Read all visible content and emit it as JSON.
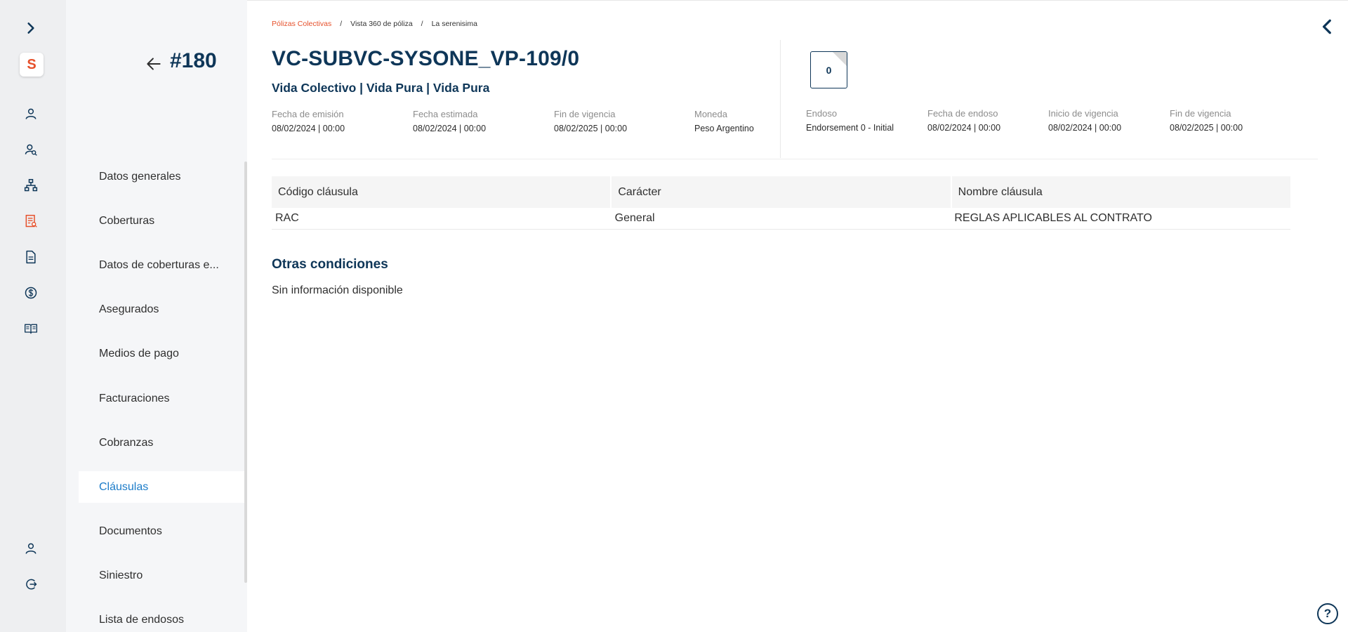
{
  "colors": {
    "accent_blue": "#1c7cc9",
    "navy": "#0e3658",
    "brand_orange": "#e6502b",
    "rail_bg": "#eeeff1"
  },
  "logo": {
    "letter": "S"
  },
  "rail": {
    "icons": [
      "chevron-right-icon",
      "user-icon",
      "users-search-icon",
      "hierarchy-icon",
      "policy-list-icon",
      "document-icon",
      "dollar-icon",
      "book-icon",
      "user-profile-icon",
      "logout-icon"
    ]
  },
  "policy": {
    "id": "#180"
  },
  "menu": {
    "items": [
      {
        "label": "Datos generales"
      },
      {
        "label": "Coberturas"
      },
      {
        "label": "Datos de coberturas e..."
      },
      {
        "label": "Asegurados"
      },
      {
        "label": "Medios de pago"
      },
      {
        "label": "Facturaciones"
      },
      {
        "label": "Cobranzas"
      },
      {
        "label": "Cláusulas"
      },
      {
        "label": "Documentos"
      },
      {
        "label": "Siniestro"
      },
      {
        "label": "Lista de endosos"
      }
    ],
    "active": "Cláusulas"
  },
  "breadcrumb": {
    "b0": "Pólizas Colectivas",
    "b1": "Vista 360 de póliza",
    "b2": "La serenisima"
  },
  "header": {
    "title": "VC-SUBVC-SYSONE_VP-109/0",
    "subtitle": "Vida Colectivo | Vida Pura | Vida Pura",
    "fields": {
      "emision": {
        "label": "Fecha de emisión",
        "value": "08/02/2024 | 00:00"
      },
      "estimada": {
        "label": "Fecha estimada",
        "value": "08/02/2024 | 00:00"
      },
      "fin": {
        "label": "Fin de vigencia",
        "value": "08/02/2025 | 00:00"
      },
      "moneda": {
        "label": "Moneda",
        "value": "Peso Argentino"
      }
    }
  },
  "endorsement": {
    "number": "0",
    "fields": {
      "endoso": {
        "label": "Endoso",
        "value": "Endorsement 0 - Initial"
      },
      "fecha": {
        "label": "Fecha de endoso",
        "value": "08/02/2024 | 00:00"
      },
      "inicio": {
        "label": "Inicio de vigencia",
        "value": "08/02/2024 | 00:00"
      },
      "fin": {
        "label": "Fin de vigencia",
        "value": "08/02/2025 | 00:00"
      }
    }
  },
  "clauses_table": {
    "headers": {
      "h0": "Código cláusula",
      "h1": "Carácter",
      "h2": "Nombre cláusula"
    },
    "rows": [
      {
        "codigo": "RAC",
        "caracter": "General",
        "nombre": "REGLAS APLICABLES AL CONTRATO"
      }
    ]
  },
  "other_conditions": {
    "title": "Otras condiciones",
    "empty": "Sin información disponible"
  },
  "help": {
    "symbol": "?"
  }
}
